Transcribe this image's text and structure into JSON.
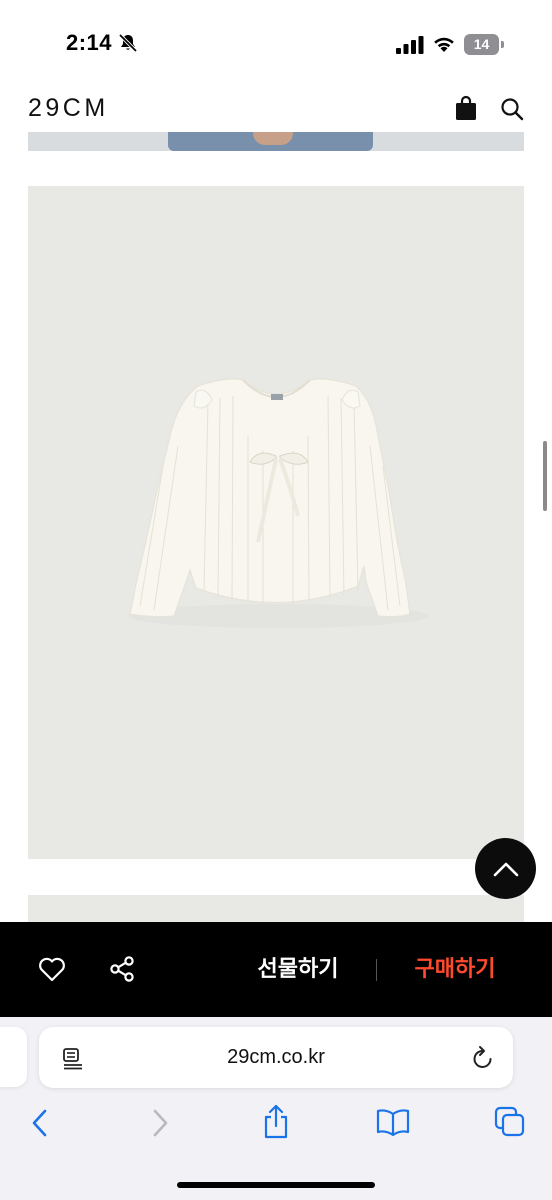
{
  "status_bar": {
    "time": "2:14",
    "battery": "14",
    "icons": [
      "bell-slash-icon",
      "cellular-signal-icon",
      "wifi-icon",
      "battery-icon"
    ]
  },
  "header": {
    "logo": "29CM",
    "icons": [
      "shopping-bag-icon",
      "search-icon"
    ]
  },
  "product": {
    "image_alt_icon": "cream-pleated-ribbon-blouse",
    "background_color": "#e8e9e5"
  },
  "action_bar": {
    "gift_label": "선물하기",
    "buy_label": "구매하기",
    "buy_color": "#ff4a2e",
    "icons": [
      "heart-icon",
      "share-icon"
    ]
  },
  "browser": {
    "url": "29cm.co.kr",
    "icons": [
      "reader-icon",
      "reload-icon",
      "back-icon",
      "forward-icon",
      "share-icon",
      "bookmarks-icon",
      "tabs-icon"
    ]
  },
  "scroll_top": {
    "icon": "chevron-up-icon"
  }
}
